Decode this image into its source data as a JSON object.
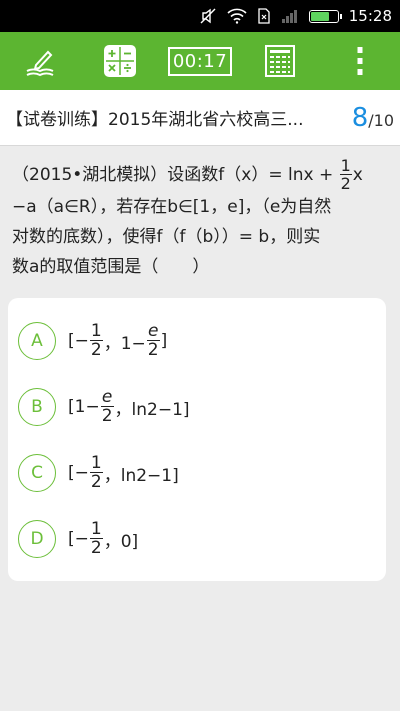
{
  "status": {
    "time": "15:28"
  },
  "toolbar": {
    "timer": "00:17"
  },
  "header": {
    "title": "【试卷训练】2015年湖北省六校高三...",
    "page_current": "8",
    "page_total": "/10"
  },
  "question": {
    "line1_a": "（2015•湖北模拟）设函数f（x）= lnx +",
    "frac_num": "1",
    "frac_den": "2",
    "line1_b": "x",
    "line2": "−a（a∈R），若存在b∈[1，e]，（e为自然",
    "line3": "对数的底数），使得f（f（b））= b，则实",
    "line4": "数a的取值范围是（　　）"
  },
  "options": [
    {
      "letter": "A",
      "p1": "[−",
      "n1": "1",
      "d1": "2",
      "p2": "，1−",
      "n2": "e",
      "d2": "2",
      "p3": "]"
    },
    {
      "letter": "B",
      "p1": "[1−",
      "n1": "e",
      "d1": "2",
      "p2": "，ln2−1]"
    },
    {
      "letter": "C",
      "p1": "[−",
      "n1": "1",
      "d1": "2",
      "p2": "，ln2−1]"
    },
    {
      "letter": "D",
      "p1": "[−",
      "n1": "1",
      "d1": "2",
      "p2": "，0]"
    }
  ]
}
